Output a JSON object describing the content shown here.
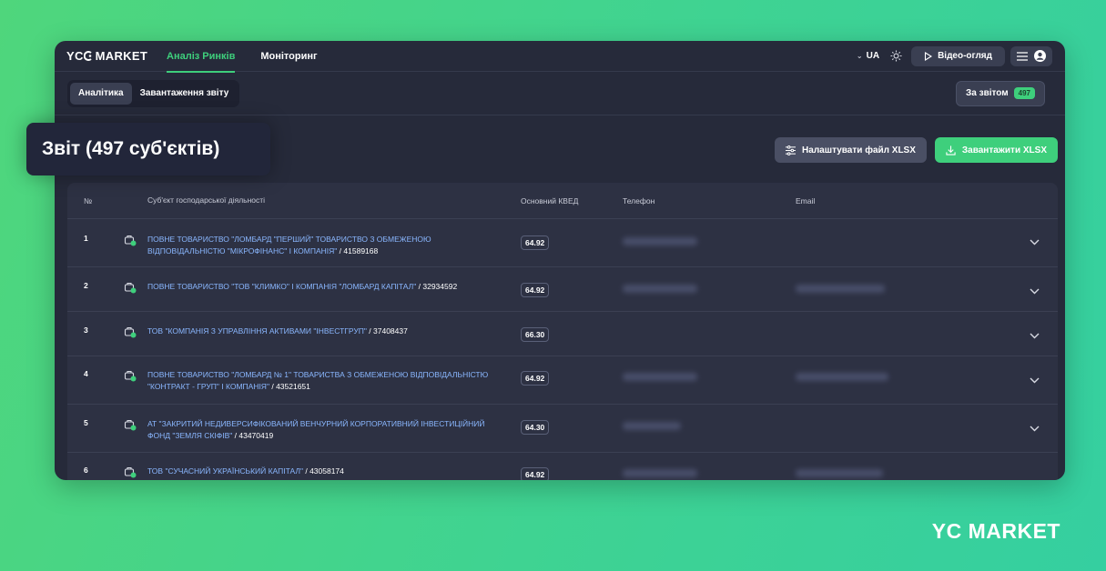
{
  "app": {
    "logo_text_left": "YC",
    "logo_text_right": "MARKET",
    "nav_tabs": [
      {
        "label": "Аналіз Ринків",
        "active": true
      },
      {
        "label": "Моніторинг",
        "active": false
      }
    ],
    "language": "UA",
    "video_button": "Відео-огляд"
  },
  "subbar": {
    "tabs": [
      {
        "label": "Аналітика",
        "active": true
      },
      {
        "label": "Завантаження звіту",
        "active": false
      }
    ],
    "report_button": "За звітом",
    "report_count": "497"
  },
  "page": {
    "title": "Звіт (497 суб'єктів)",
    "settings_button": "Налаштувати файл XLSX",
    "download_button": "Завантажити XLSX"
  },
  "table": {
    "headers": {
      "num": "№",
      "name": "Суб'єкт господарської діяльності",
      "kved": "Основний КВЕД",
      "phone": "Телефон",
      "email": "Email"
    },
    "rows": [
      {
        "num": "1",
        "name_line1": "ПОВНЕ ТОВАРИСТВО \"ЛОМБАРД \"ПЕРШИЙ\" ТОВАРИСТВО З ОБМЕЖЕНОЮ",
        "name_line2": "ВІДПОВІДАЛЬНІСТЮ \"МІКРОФІНАНС\" І КОМПАНІЯ\"",
        "code": "41589168",
        "kved": "64.92"
      },
      {
        "num": "2",
        "name_line1": "ПОВНЕ ТОВАРИСТВО \"ТОВ \"КЛИМКО\" І КОМПАНІЯ \"ЛОМБАРД КАПІТАЛ\"",
        "name_line2": "",
        "code": "32934592",
        "kved": "64.92"
      },
      {
        "num": "3",
        "name_line1": "ТОВ \"КОМПАНІЯ З УПРАВЛІННЯ АКТИВАМИ \"ІНВЕСТГРУП\"",
        "name_line2": "",
        "code": "37408437",
        "kved": "66.30"
      },
      {
        "num": "4",
        "name_line1": "ПОВНЕ ТОВАРИСТВО \"ЛОМБАРД № 1\" ТОВАРИСТВА З ОБМЕЖЕНОЮ ВІДПОВІДАЛЬНІСТЮ",
        "name_line2": "\"КОНТРАКТ - ГРУП\" І КОМПАНІЯ\"",
        "code": "43521651",
        "kved": "64.92"
      },
      {
        "num": "5",
        "name_line1": "АТ \"ЗАКРИТИЙ НЕДИВЕРСИФІКОВАНИЙ ВЕНЧУРНИЙ КОРПОРАТИВНИЙ ІНВЕСТИЦІЙНИЙ",
        "name_line2": "ФОНД \"ЗЕМЛЯ СКІФІВ\"",
        "code": "43470419",
        "kved": "64.30"
      },
      {
        "num": "6",
        "name_line1": "ТОВ \"СУЧАСНИЙ УКРАЇНСЬКИЙ КАПІТАЛ\"",
        "name_line2": "",
        "code": "43058174",
        "kved": "64.92"
      }
    ]
  },
  "footer_brand": "YC MARKET",
  "colors": {
    "accent": "#3ecf7c",
    "link": "#8ab7ff",
    "window": "#262a3a"
  }
}
